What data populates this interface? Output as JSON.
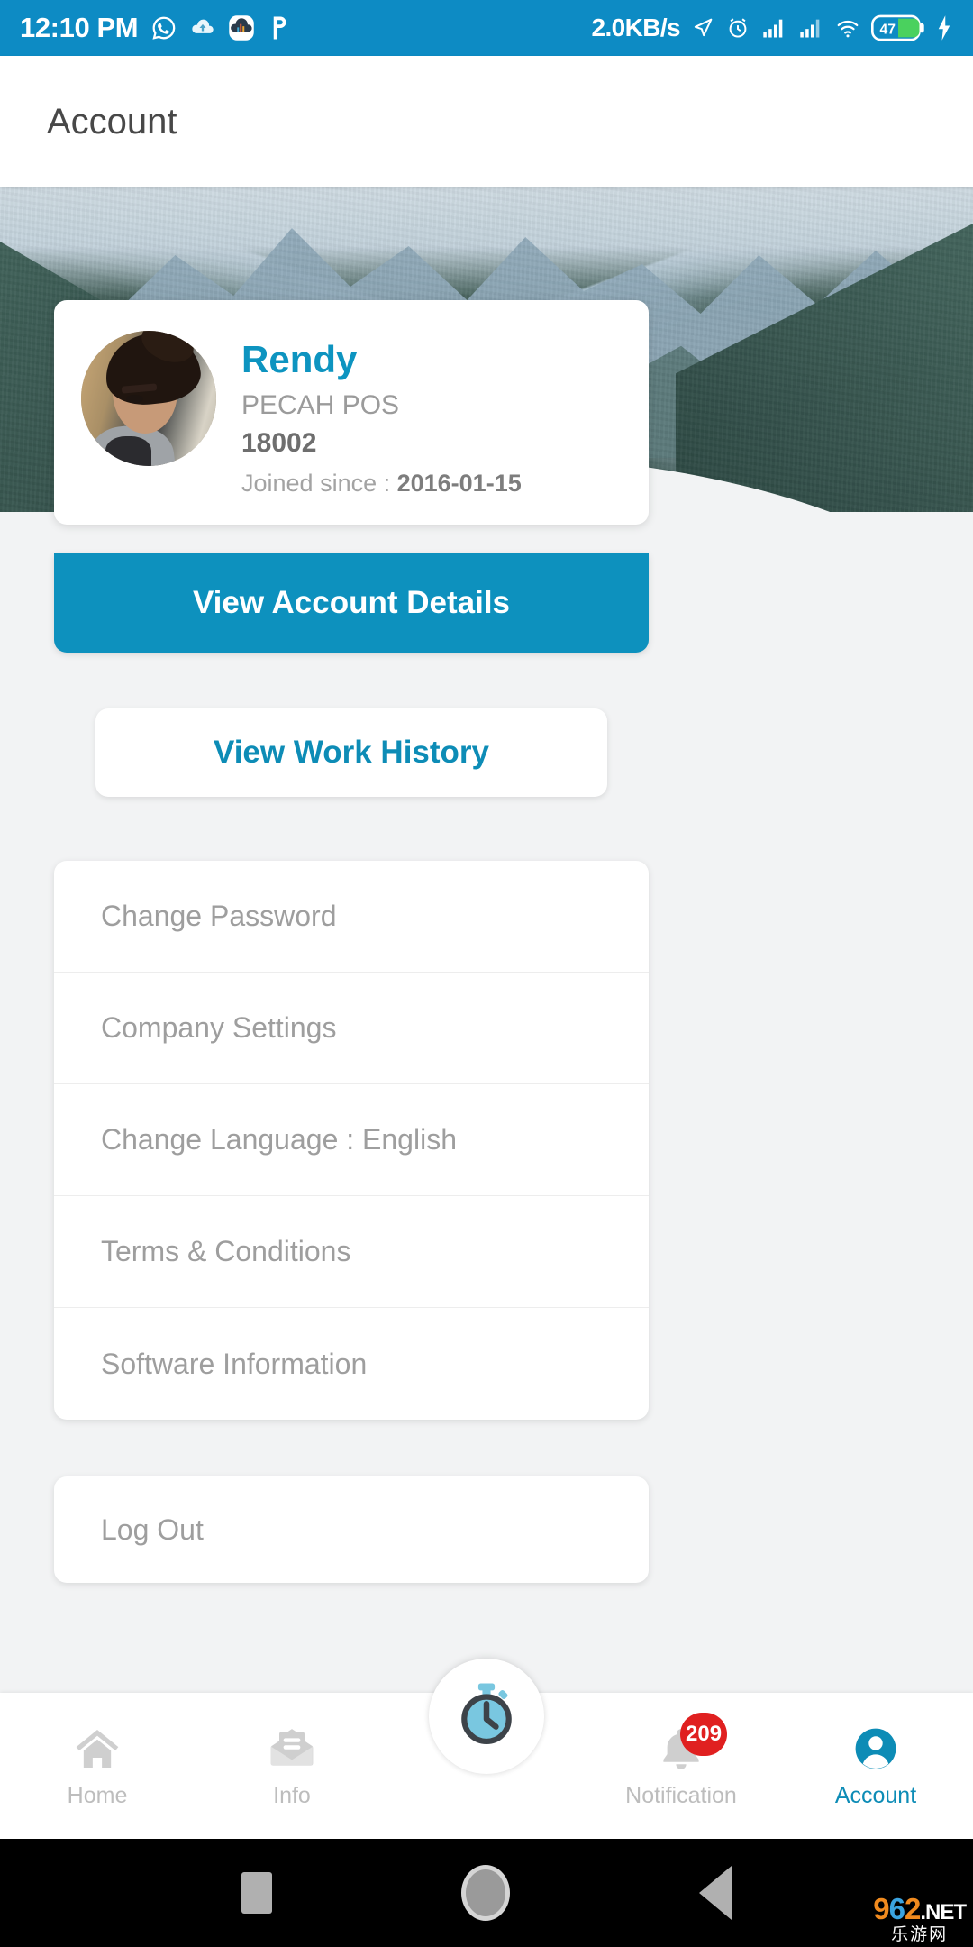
{
  "status_bar": {
    "time": "12:10 PM",
    "network_speed": "2.0KB/s",
    "battery_level": "47",
    "left_icons": [
      "whatsapp-icon",
      "cloud-icon",
      "cloud-app-icon",
      "p-app-icon"
    ],
    "right_icons": [
      "location-arrow-icon",
      "alarm-icon",
      "signal-bars-icon",
      "signal-bars-2-icon",
      "wifi-icon",
      "battery-icon",
      "charging-bolt-icon"
    ],
    "background_color": "#0d8bc4"
  },
  "app_bar": {
    "title": "Account"
  },
  "profile": {
    "name": "Rendy",
    "company": "PECAH POS",
    "employee_id": "18002",
    "joined_label": "Joined since : ",
    "joined_date": "2016-01-15",
    "name_color": "#0d94c0"
  },
  "actions": {
    "view_account_details": "View Account Details",
    "view_work_history": "View Work History",
    "primary_color": "#0d91be"
  },
  "menu": {
    "items": [
      {
        "label": "Change Password"
      },
      {
        "label": "Company Settings"
      },
      {
        "label": "Change Language : English"
      },
      {
        "label": "Terms & Conditions"
      },
      {
        "label": "Software Information"
      }
    ],
    "logout": "Log Out"
  },
  "bottom_nav": {
    "items": [
      {
        "label": "Home",
        "icon": "home-icon",
        "active": false
      },
      {
        "label": "Info",
        "icon": "mail-info-icon",
        "active": false
      },
      {
        "label": "Notification",
        "icon": "bell-icon",
        "active": false,
        "badge": "209"
      },
      {
        "label": "Account",
        "icon": "person-icon",
        "active": true
      }
    ],
    "fab_icon": "stopwatch-icon",
    "active_color": "#0d8cb6",
    "inactive_color": "#bdbdbd",
    "badge_color": "#e02020"
  },
  "android_nav": {
    "buttons": [
      "recents-square-icon",
      "home-circle-icon",
      "back-triangle-icon"
    ]
  },
  "watermark": {
    "digit_9": "9",
    "digit_6": "6",
    "digit_2": "2",
    "suffix": ".NET",
    "subtitle": "乐游网"
  }
}
